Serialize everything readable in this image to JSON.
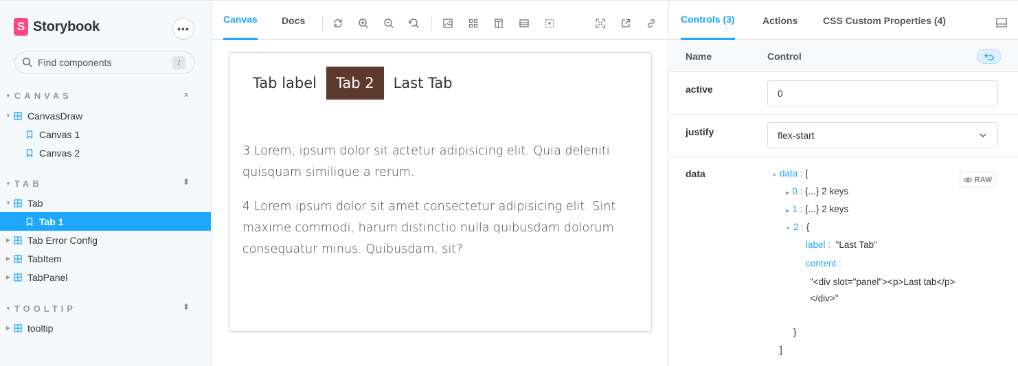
{
  "sidebar": {
    "brand": "Storybook",
    "brand_letter": "S",
    "menu_label": "•••",
    "search_placeholder": "Find components",
    "search_shortcut": "/",
    "sections": [
      {
        "title": "CANVAS",
        "items": [
          {
            "label": "CanvasDraw",
            "type": "component"
          },
          {
            "label": "Canvas 1",
            "type": "story"
          },
          {
            "label": "Canvas 2",
            "type": "story"
          }
        ]
      },
      {
        "title": "TAB",
        "items": [
          {
            "label": "Tab",
            "type": "component"
          },
          {
            "label": "Tab 1",
            "type": "story",
            "selected": true
          },
          {
            "label": "Tab Error Config",
            "type": "component"
          },
          {
            "label": "TabItem",
            "type": "component"
          },
          {
            "label": "TabPanel",
            "type": "component"
          }
        ]
      },
      {
        "title": "TOOLTIP",
        "items": [
          {
            "label": "tooltip",
            "type": "component"
          }
        ]
      }
    ]
  },
  "canvas_toolbar": {
    "tabs": [
      "Canvas",
      "Docs"
    ],
    "active_tab": "Canvas"
  },
  "preview": {
    "tabs": [
      "Tab label",
      "Tab 2",
      "Last Tab"
    ],
    "active_tab": "Tab 2",
    "paragraphs": [
      "3 Lorem, ipsum dolor sit actetur adipisicing elit. Quia deleniti quisquam similique a rerum.",
      "4 Lorem ipsum dolor sit amet consectetur adipisicing elit. Sint maxime commodi, harum distinctio nulla quibusdam dolorum consequatur minus. Quibusdam, sit?"
    ],
    "active_tab_color": "#5d3a2e"
  },
  "addons": {
    "tabs": [
      "Controls (3)",
      "Actions",
      "CSS Custom Properties (4)"
    ],
    "active_tab": "Controls (3)",
    "header": {
      "name": "Name",
      "control": "Control"
    },
    "controls": {
      "active": {
        "name": "active",
        "value": "0"
      },
      "justify": {
        "name": "justify",
        "value": "flex-start"
      },
      "data": {
        "name": "data",
        "raw_label": "RAW",
        "root_key": "data",
        "root_open": "[",
        "item0_key": "0",
        "item0_summary": "{...} 2 keys",
        "item1_key": "1",
        "item1_summary": "{...} 2 keys",
        "item2_key": "2",
        "item2_open": "{",
        "label_key": "label",
        "label_value": "\"Last Tab\"",
        "content_key": "content",
        "content_value_line1": "\"<div slot=\"panel\"><p>Last tab</p>",
        "content_value_line2": "</div>\"",
        "item2_close": "}",
        "root_close": "]"
      }
    }
  },
  "colors": {
    "accent": "#1ea7fd",
    "brand": "#ff4785"
  }
}
